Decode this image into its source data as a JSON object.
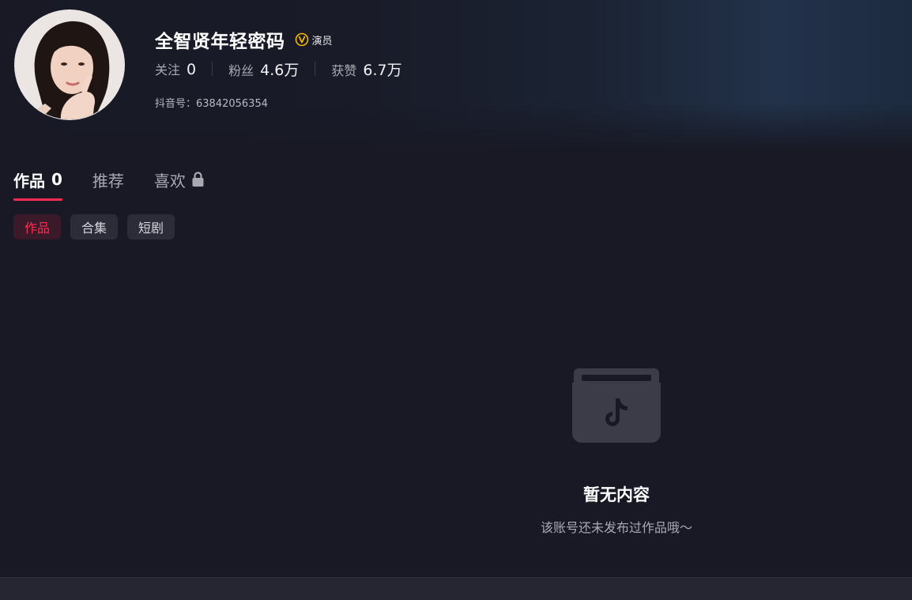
{
  "profile": {
    "name": "全智贤年轻密码",
    "verify_label": "演员",
    "stats": [
      {
        "label": "关注",
        "value": "0"
      },
      {
        "label": "粉丝",
        "value": "4.6万"
      },
      {
        "label": "获赞",
        "value": "6.7万"
      }
    ],
    "douyin_id": "抖音号：63842056354"
  },
  "tabs": [
    {
      "label": "作品",
      "count": "0",
      "active": true
    },
    {
      "label": "推荐"
    },
    {
      "label": "喜欢",
      "locked": true
    }
  ],
  "chips": [
    {
      "label": "作品",
      "active": true
    },
    {
      "label": "合集"
    },
    {
      "label": "短剧"
    }
  ],
  "empty_state": {
    "title": "暂无内容",
    "subtitle": "该账号还未发布过作品哦～"
  },
  "colors": {
    "accent": "#fe2c55",
    "background": "#181925",
    "verify_badge": "#f5b700"
  }
}
